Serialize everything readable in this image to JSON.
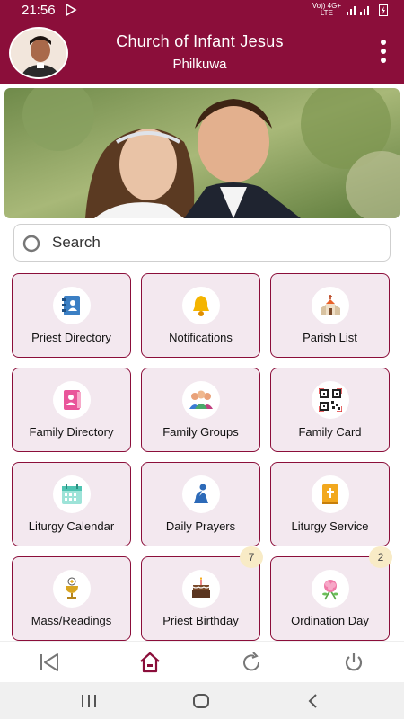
{
  "status_bar": {
    "time": "21:56",
    "network_top": "Vo)) 4G+",
    "network_bottom": "LTE",
    "icons": [
      "play-icon",
      "signal-icon",
      "battery-icon"
    ]
  },
  "app_bar": {
    "title": "Church of Infant Jesus",
    "subtitle": "Philkuwa",
    "avatar_icon": "priest-avatar",
    "menu_icon": "more-vert-icon"
  },
  "banner": {
    "image": "wedding-couple-photo"
  },
  "search": {
    "placeholder": "Search"
  },
  "tiles": [
    {
      "label": "Priest Directory",
      "icon": "directory-book-icon"
    },
    {
      "label": "Notifications",
      "icon": "bell-icon"
    },
    {
      "label": "Parish List",
      "icon": "church-icon"
    },
    {
      "label": "Family Directory",
      "icon": "family-book-icon"
    },
    {
      "label": "Family Groups",
      "icon": "group-icon"
    },
    {
      "label": "Family Card",
      "icon": "qr-code-icon"
    },
    {
      "label": "Liturgy Calendar",
      "icon": "calendar-icon"
    },
    {
      "label": "Daily Prayers",
      "icon": "praying-person-icon"
    },
    {
      "label": "Liturgy Service",
      "icon": "bible-icon"
    },
    {
      "label": "Mass/Readings",
      "icon": "chalice-icon"
    },
    {
      "label": "Priest Birthday",
      "icon": "cake-icon",
      "badge": "7"
    },
    {
      "label": "Ordination Day",
      "icon": "flower-icon",
      "badge": "2"
    }
  ],
  "bottom_nav": [
    "back-icon",
    "home-icon",
    "refresh-icon",
    "power-icon"
  ],
  "system_nav": [
    "recent-apps-icon",
    "home-circle-icon",
    "system-back-icon"
  ],
  "colors": {
    "primary": "#8b0e3a",
    "tile_bg": "#f3e8ef",
    "badge_bg": "#f8ebc6"
  }
}
